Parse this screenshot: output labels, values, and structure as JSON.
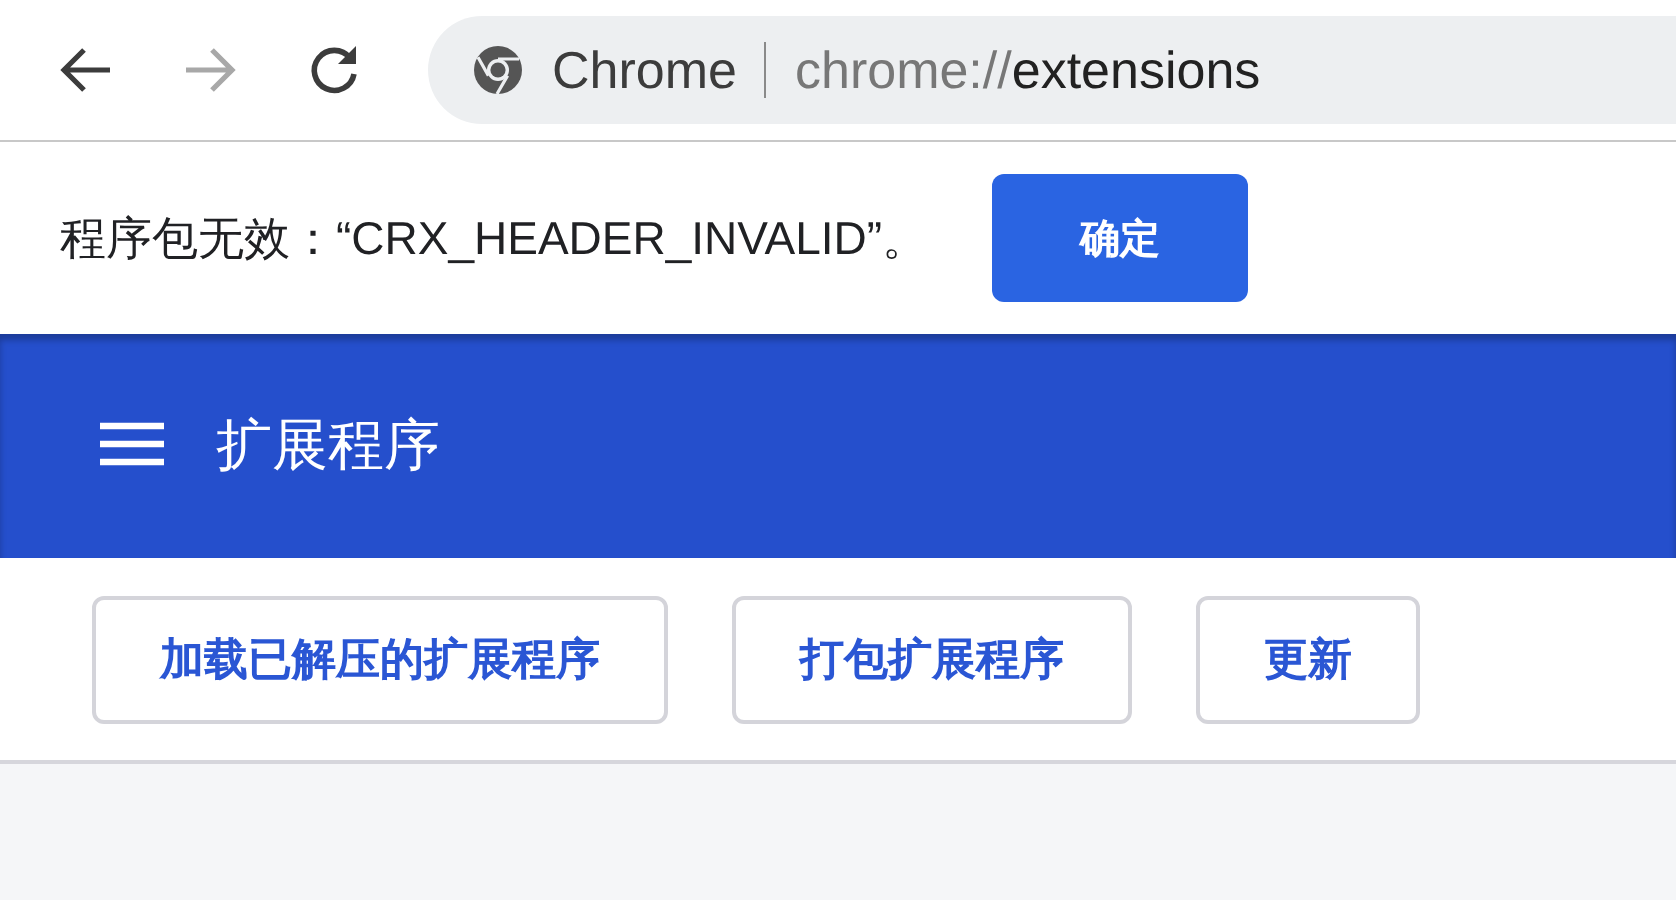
{
  "toolbar": {
    "back": {
      "disabled": false
    },
    "forward": {
      "disabled": true
    },
    "site_label": "Chrome",
    "url": {
      "scheme": "chrome://",
      "rest": "extensions"
    }
  },
  "infobar": {
    "message": "程序包无效：“CRX_HEADER_INVALID”。",
    "button": "确定"
  },
  "header": {
    "title": "扩展程序"
  },
  "actions": [
    "加载已解压的扩展程序",
    "打包扩展程序",
    "更新"
  ]
}
